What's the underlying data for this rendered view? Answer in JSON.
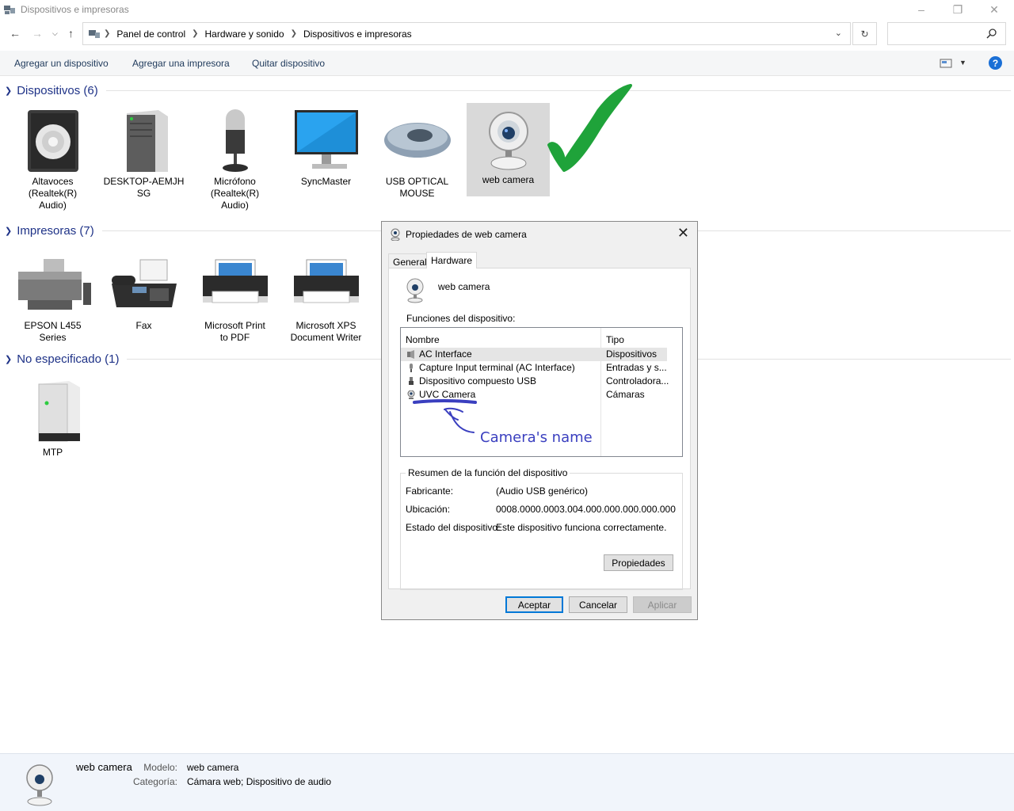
{
  "window": {
    "title": "Dispositivos e impresoras"
  },
  "breadcrumb": [
    "Panel de control",
    "Hardware y sonido",
    "Dispositivos e impresoras"
  ],
  "commands": [
    "Agregar un dispositivo",
    "Agregar una impresora",
    "Quitar dispositivo"
  ],
  "groups": {
    "devices": {
      "title": "Dispositivos (6)"
    },
    "printers": {
      "title": "Impresoras (7)"
    },
    "unspecified": {
      "title": "No especificado (1)"
    }
  },
  "devices": [
    {
      "name": "Altavoces\n(Realtek(R)\nAudio)",
      "icon": "speaker-icon"
    },
    {
      "name": "DESKTOP-AEMJH\nSG",
      "icon": "computer-tower-icon"
    },
    {
      "name": "Micrófono\n(Realtek(R)\nAudio)",
      "icon": "microphone-icon"
    },
    {
      "name": "SyncMaster",
      "icon": "monitor-icon"
    },
    {
      "name": "USB OPTICAL\nMOUSE",
      "icon": "mouse-icon"
    },
    {
      "name": "web camera",
      "icon": "webcam-icon"
    }
  ],
  "printers": [
    {
      "name": "EPSON L455\nSeries",
      "icon": "inkjet-printer-icon"
    },
    {
      "name": "Fax",
      "icon": "fax-icon"
    },
    {
      "name": "Microsoft Print\nto PDF",
      "icon": "printer-icon"
    },
    {
      "name": "Microsoft XPS\nDocument Writer",
      "icon": "printer-icon"
    }
  ],
  "unspecified": [
    {
      "name": "MTP",
      "icon": "device-box-icon"
    }
  ],
  "dialog": {
    "title": "Propiedades de web camera",
    "tabs": [
      "General",
      "Hardware"
    ],
    "device_name": "web camera",
    "functions_label": "Funciones del dispositivo:",
    "columns": [
      "Nombre",
      "Tipo"
    ],
    "rows": [
      {
        "name": "AC Interface",
        "type": "Dispositivos ..."
      },
      {
        "name": "Capture Input terminal (AC Interface)",
        "type": "Entradas y s..."
      },
      {
        "name": "Dispositivo compuesto USB",
        "type": "Controladora..."
      },
      {
        "name": "UVC Camera",
        "type": "Cámaras"
      }
    ],
    "summary_legend": "Resumen de la función del dispositivo",
    "summary": {
      "manufacturer_label": "Fabricante:",
      "manufacturer": "(Audio USB genérico)",
      "location_label": "Ubicación:",
      "location": "0008.0000.0003.004.000.000.000.000.000",
      "status_label": "Estado del dispositivo:",
      "status": "Este dispositivo funciona correctamente."
    },
    "properties_button": "Propiedades",
    "ok_button": "Aceptar",
    "cancel_button": "Cancelar",
    "apply_button": "Aplicar"
  },
  "annotation": {
    "text": "Camera's name",
    "color": "#3a3fbf",
    "check_color": "#1fa33a"
  },
  "details": {
    "name": "web camera",
    "model_label": "Modelo:",
    "model": "web camera",
    "category_label": "Categoría:",
    "category": "Cámara web; Dispositivo de audio"
  }
}
